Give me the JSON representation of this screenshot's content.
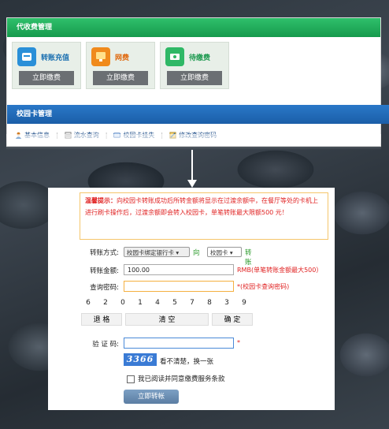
{
  "top": {
    "collection_title": "代收费管理",
    "items": [
      {
        "label": "转账充值",
        "button": "立即缴费",
        "icon": "transfer-icon",
        "color": "#1a6fb0",
        "icon_bg": "#2a8fd8"
      },
      {
        "label": "网费",
        "button": "立即缴费",
        "icon": "network-fee-icon",
        "color": "#e06a10",
        "icon_bg": "#f08a1c"
      },
      {
        "label": "待缴费",
        "button": "立即缴费",
        "icon": "pending-fee-icon",
        "color": "#1e9a50",
        "icon_bg": "#2fb866"
      }
    ],
    "campus_title": "校园卡管理",
    "links": [
      {
        "label": "基本信息",
        "icon": "user-icon"
      },
      {
        "label": "流水查询",
        "icon": "statement-icon"
      },
      {
        "label": "校园卡挂失",
        "icon": "card-icon"
      },
      {
        "label": "修改查询密码",
        "icon": "edit-password-icon"
      }
    ]
  },
  "form": {
    "notice_title": "温馨提示：",
    "notice_text": "向校园卡转账成功后所转金额将显示在过渡余额中，在餐厅等处的卡机上进行刷卡操作后，过渡余额即会转入校园卡，单笔转账最大限额500 元！",
    "method_label": "转账方式:",
    "method_select": "校园卡绑定银行卡",
    "to_text": "向",
    "target_select": "校园卡",
    "transfer_text": "转账",
    "amount_label": "转账金额:",
    "amount_value": "100.00",
    "amount_hint": "RMB(单笔转账金额最大500）",
    "password_label": "查询密码:",
    "password_hint": "*(校园卡查询密码)",
    "keypad_digits": [
      "6",
      "2",
      "0",
      "1",
      "4",
      "5",
      "7",
      "8",
      "3",
      "9"
    ],
    "keypad_back": "退 格",
    "keypad_clear": "清 空",
    "keypad_ok": "确 定",
    "captcha_label": "验 证 码:",
    "captcha_required": "*",
    "captcha_image": "3366",
    "captcha_refresh": "看不清楚，换一张",
    "agree_text": "我已阅读并同意缴费服务条款",
    "submit": "立即转帐"
  }
}
